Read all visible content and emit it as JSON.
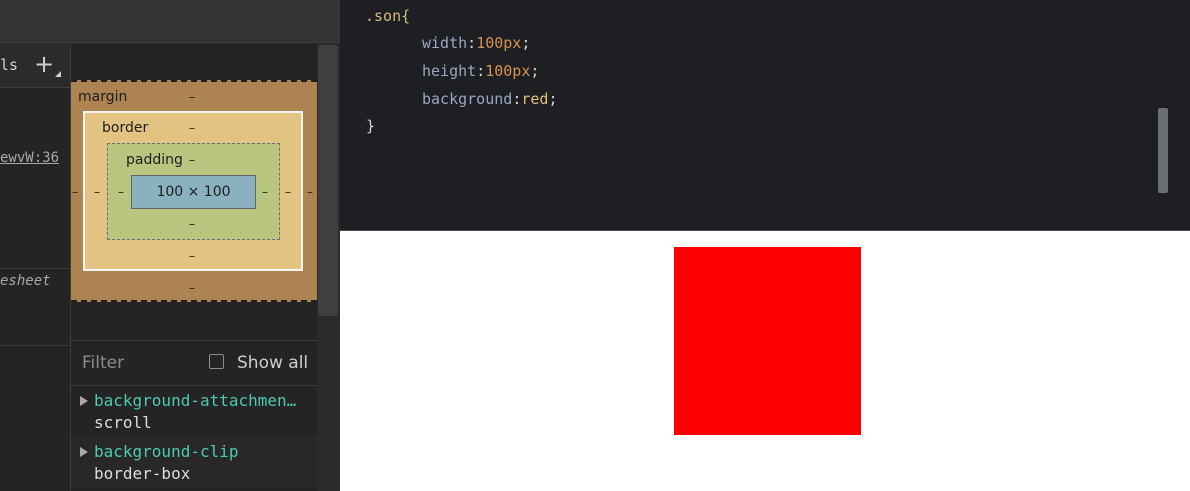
{
  "devtools": {
    "tab_partial": "ls",
    "add_label": "+",
    "style_source": "ewvW:36",
    "stylesheet_label": "esheet",
    "box_model": {
      "margin_label": "margin",
      "margin_top": "–",
      "margin_bottom": "–",
      "margin_left": "–",
      "margin_right": "–",
      "border_label": "border",
      "border_top": "–",
      "border_bottom": "–",
      "border_left": "–",
      "border_right": "–",
      "padding_label": "padding",
      "padding_top": "–",
      "padding_bottom": "–",
      "padding_left": "–",
      "padding_right": "–",
      "content_size": "100 × 100"
    },
    "filter_placeholder": "Filter",
    "show_all_label": "Show all",
    "show_all_checked": false,
    "computed": [
      {
        "name": "background-attachmen…",
        "value": "scroll"
      },
      {
        "name": "background-clip",
        "value": "border-box"
      }
    ]
  },
  "editor": {
    "selector": ".son{",
    "lines": [
      {
        "prop": "width",
        "value": "100px",
        "type": "num"
      },
      {
        "prop": "height",
        "value": "100px",
        "type": "num"
      },
      {
        "prop": "background",
        "value": "red",
        "type": "kw"
      }
    ],
    "closing": "}"
  },
  "preview": {
    "box_color": "#ff0000"
  }
}
